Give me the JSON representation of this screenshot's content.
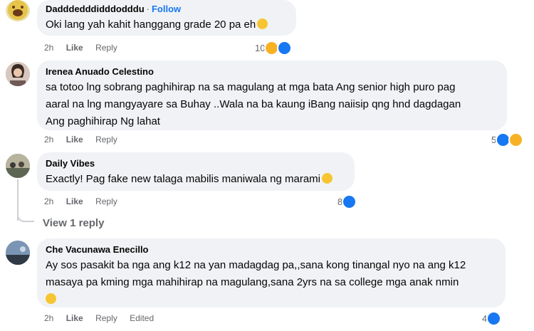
{
  "comments": [
    {
      "author": "Dadddedddidddodddu",
      "follow": "Follow",
      "text": "Oki lang yah kahit hanggang grade 20 pa eh",
      "time": "2h",
      "like": "Like",
      "reply": "Reply",
      "reaction_count": "10",
      "reactions": [
        "haha-icon",
        "like-icon"
      ]
    },
    {
      "author": "Irenea Anuado Celestino",
      "text_lines": [
        "sa totoo lng sobrang paghihirap na sa magulang at mga bata Ang senior high puro pag",
        "aaral na lng mangyayare sa Buhay ..Wala na ba kaung iBang naiisip qng hnd dagdagan",
        "Ang paghihirap Ng lahat"
      ],
      "time": "2h",
      "like": "Like",
      "reply": "Reply",
      "reaction_count": "5",
      "reactions": [
        "like-icon",
        "haha-icon"
      ]
    },
    {
      "author": "Daily Vibes",
      "text": "Exactly! Pag fake new talaga mabilis maniwala ng marami",
      "time": "2h",
      "like": "Like",
      "reply": "Reply",
      "reaction_count": "8",
      "reactions": [
        "like-icon"
      ],
      "view_replies": "View 1 reply"
    },
    {
      "author": "Che Vacunawa Enecillo",
      "text_lines": [
        "Ay sos pasakit ba nga ang k12 na yan madagdag pa,,sana kong tinangal nyo na ang k12",
        "masaya pa kming mga mahihirap na magulang,sana 2yrs na sa college mga anak nmin"
      ],
      "time": "2h",
      "like": "Like",
      "reply": "Reply",
      "edited": "Edited",
      "reaction_count": "4",
      "reactions": [
        "like-icon"
      ]
    }
  ],
  "colors": {
    "bubble": "#f0f2f5",
    "link_blue": "#1877f2",
    "meta_gray": "#65676b",
    "haha_yellow": "#f7b125"
  }
}
